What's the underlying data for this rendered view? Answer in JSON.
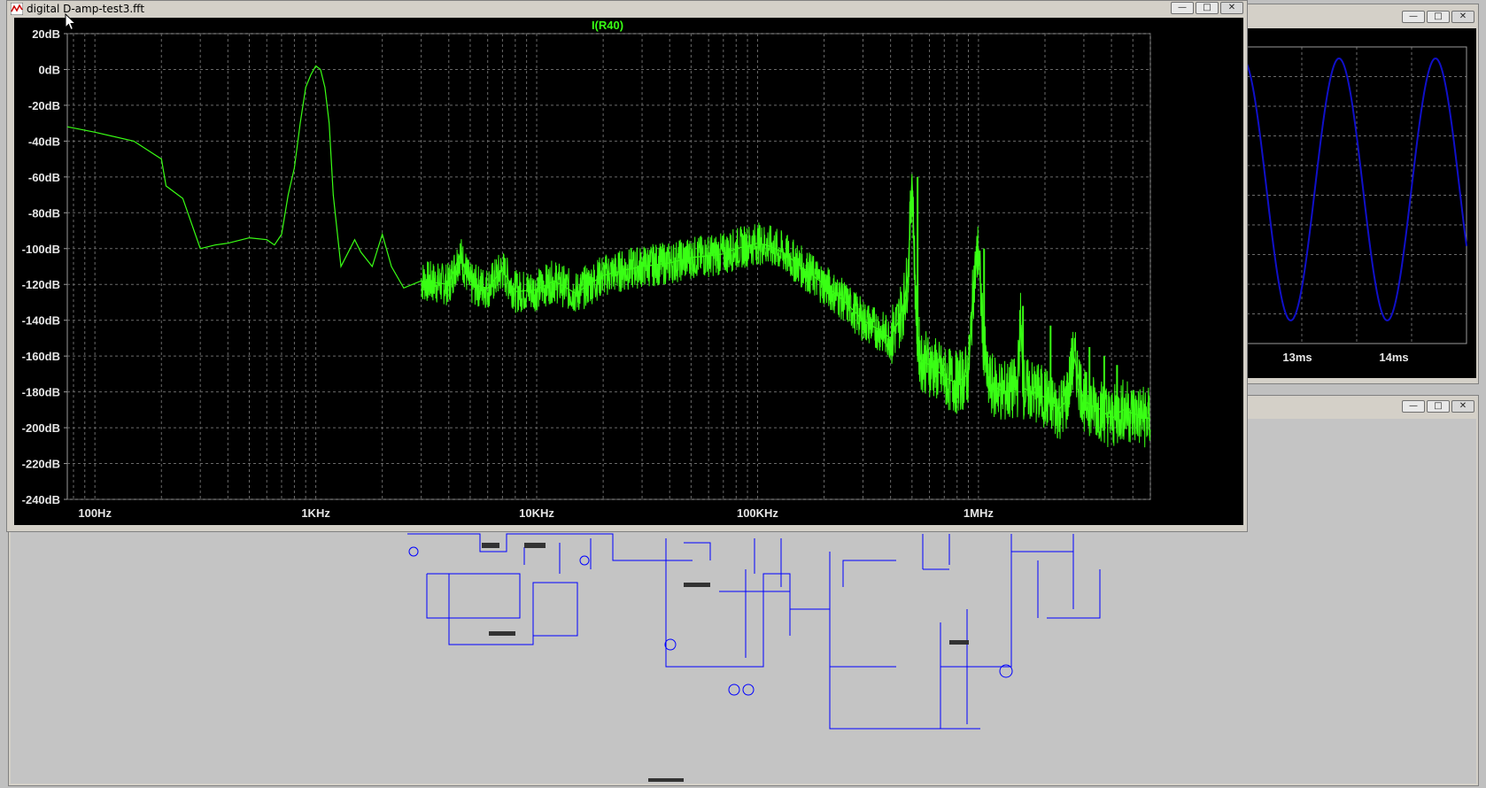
{
  "fft_window": {
    "title": "digital D-amp-test3.fft",
    "trace_label": "I(R40)",
    "buttons": {
      "minimize": "—",
      "maximize": "□",
      "close": "✕"
    }
  },
  "wave_window": {
    "buttons": {
      "minimize": "—",
      "maximize": "□",
      "close": "✕"
    },
    "x_ticks": [
      "13ms",
      "14ms"
    ]
  },
  "schematic_window": {
    "buttons": {
      "minimize": "—",
      "maximize": "□",
      "close": "✕"
    }
  },
  "colors": {
    "trace": "#39ff14",
    "wave": "#1010c8",
    "plot_bg": "#000000",
    "grid": "#6a6a6a",
    "schematic_wire": "#0000ff"
  },
  "chart_data": {
    "type": "line",
    "title": "I(R40)",
    "x_scale": "log",
    "xlim_hz": [
      75,
      6000000
    ],
    "ylim_db": [
      -240,
      20
    ],
    "y_ticks": [
      "20dB",
      "0dB",
      "-20dB",
      "-40dB",
      "-60dB",
      "-80dB",
      "-100dB",
      "-120dB",
      "-140dB",
      "-160dB",
      "-180dB",
      "-200dB",
      "-220dB",
      "-240dB"
    ],
    "y_tick_values": [
      20,
      0,
      -20,
      -40,
      -60,
      -80,
      -100,
      -120,
      -140,
      -160,
      -180,
      -200,
      -220,
      -240
    ],
    "x_ticks": [
      "100Hz",
      "1KHz",
      "10KHz",
      "100KHz",
      "1MHz"
    ],
    "x_tick_values": [
      100,
      1000,
      10000,
      100000,
      1000000
    ],
    "grid": true,
    "series": [
      {
        "x": [
          75,
          100,
          150,
          200,
          210,
          250,
          300,
          350,
          400,
          500,
          600,
          650,
          700,
          750,
          800,
          850,
          900,
          950,
          1000,
          1050,
          1100,
          1150,
          1200,
          1300,
          1500,
          1600,
          1800,
          2000,
          2200,
          2500,
          3000,
          4000,
          4500,
          5000,
          6000,
          7000,
          8000,
          10000,
          12000,
          15000,
          20000,
          25000,
          30000,
          40000,
          50000,
          60000,
          70000,
          80000,
          100000,
          110000,
          130000,
          150000,
          200000,
          250000,
          300000,
          350000,
          400000,
          430000,
          460000,
          480000,
          500000,
          510000,
          520000,
          530000,
          550000,
          600000,
          650000,
          700000,
          800000,
          900000,
          950000,
          1000000,
          1050000,
          1100000,
          1300000,
          1500000,
          1550000,
          1600000,
          2000000,
          2300000,
          2500000,
          2700000,
          3000000,
          3300000,
          3600000,
          4000000,
          4500000,
          5000000,
          6000000
        ],
        "y": [
          -32,
          -35,
          -40,
          -50,
          -65,
          -72,
          -100,
          -98,
          -97,
          -94,
          -95,
          -98,
          -92,
          -70,
          -55,
          -30,
          -10,
          -3,
          2,
          0,
          -10,
          -30,
          -70,
          -110,
          -95,
          -102,
          -110,
          -92,
          -110,
          -122,
          -118,
          -120,
          -103,
          -120,
          -122,
          -112,
          -124,
          -123,
          -118,
          -125,
          -115,
          -112,
          -110,
          -108,
          -105,
          -104,
          -103,
          -100,
          -97,
          -98,
          -102,
          -108,
          -120,
          -130,
          -140,
          -145,
          -150,
          -142,
          -130,
          -115,
          -60,
          -95,
          -130,
          -150,
          -162,
          -165,
          -168,
          -172,
          -175,
          -170,
          -120,
          -100,
          -150,
          -175,
          -180,
          -178,
          -140,
          -178,
          -183,
          -190,
          -185,
          -160,
          -185,
          -188,
          -190,
          -195,
          -190,
          -192,
          -195
        ],
        "spikes": [
          {
            "x": 530000,
            "y": -60
          },
          {
            "x": 1060000,
            "y": -100
          },
          {
            "x": 1590000,
            "y": -132
          },
          {
            "x": 2120000,
            "y": -143
          },
          {
            "x": 2650000,
            "y": -150
          },
          {
            "x": 3180000,
            "y": -155
          },
          {
            "x": 3710000,
            "y": -160
          },
          {
            "x": 4240000,
            "y": -165
          }
        ]
      }
    ]
  },
  "wave_data": {
    "type": "line",
    "shape": "sine"
  }
}
